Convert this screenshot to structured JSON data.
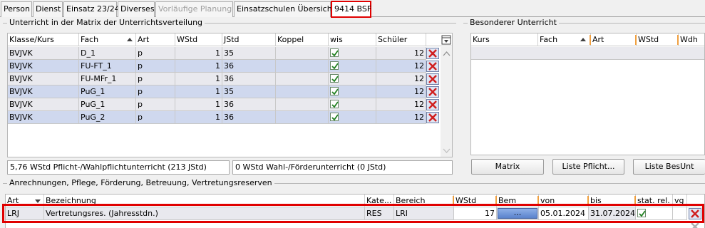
{
  "tabs": [
    {
      "label": "Person",
      "state": "normal"
    },
    {
      "label": "Dienst",
      "state": "normal"
    },
    {
      "label": "Einsatz 23/24",
      "state": "normal"
    },
    {
      "label": "Diverses",
      "state": "normal"
    },
    {
      "label": "Vorläufige Planung",
      "state": "disabled"
    },
    {
      "label": "Einsatzschulen Übersicht",
      "state": "normal"
    },
    {
      "label": "9414 BSF",
      "state": "active"
    }
  ],
  "matrix": {
    "title": "Unterricht in der Matrix der Unterrichtsverteilung",
    "columns": [
      "Klasse/Kurs",
      "Fach",
      "Art",
      "WStd",
      "JStd",
      "Koppel",
      "wis",
      "Schüler"
    ],
    "rows": [
      {
        "klasse": "BVJVK",
        "fach": "D_1",
        "art": "p",
        "wstd": "1",
        "jstd": "35",
        "koppel": "",
        "wis": true,
        "schueler": "12"
      },
      {
        "klasse": "BVJVK",
        "fach": "FU-FT_1",
        "art": "p",
        "wstd": "1",
        "jstd": "36",
        "koppel": "",
        "wis": true,
        "schueler": "12"
      },
      {
        "klasse": "BVJVK",
        "fach": "FU-MFr_1",
        "art": "p",
        "wstd": "1",
        "jstd": "36",
        "koppel": "",
        "wis": true,
        "schueler": "12"
      },
      {
        "klasse": "BVJVK",
        "fach": "PuG_1",
        "art": "p",
        "wstd": "1",
        "jstd": "35",
        "koppel": "",
        "wis": true,
        "schueler": "12"
      },
      {
        "klasse": "BVJVK",
        "fach": "PuG_1",
        "art": "p",
        "wstd": "1",
        "jstd": "36",
        "koppel": "",
        "wis": true,
        "schueler": "12"
      },
      {
        "klasse": "BVJVK",
        "fach": "PuG_2",
        "art": "p",
        "wstd": "1",
        "jstd": "36",
        "koppel": "",
        "wis": true,
        "schueler": "12"
      }
    ],
    "summary_pflicht": "5,76 WStd Pflicht-/Wahlpflichtunterricht (213 JStd)",
    "summary_wahl": "0 WStd Wahl-/Förderunterricht (0 JStd)"
  },
  "besonderer": {
    "title": "Besonderer Unterricht",
    "columns": [
      "Kurs",
      "Fach",
      "Art",
      "WStd",
      "Wdh"
    ]
  },
  "buttons": {
    "matrix": "Matrix",
    "liste_pflicht": "Liste Pflicht...",
    "liste_besunt": "Liste BesUnt"
  },
  "anrechnungen": {
    "title": "Anrechnungen, Pflege, Förderung, Betreuung, Vertretungsreserven",
    "columns": [
      "Art",
      "Bezeichnung",
      "Kate...",
      "Bereich",
      "WStd",
      "Bem",
      "von",
      "bis",
      "stat. rel.",
      "vg"
    ],
    "rows": [
      {
        "art": "LRJ",
        "bezeichnung": "Vertretungsres. (Jahresstdn.)",
        "kategorie": "RES",
        "bereich": "LRI",
        "wstd": "17",
        "bem": "...",
        "von": "05.01.2024",
        "bis": "31.07.2024",
        "stat_rel": true,
        "vg": ""
      }
    ]
  }
}
